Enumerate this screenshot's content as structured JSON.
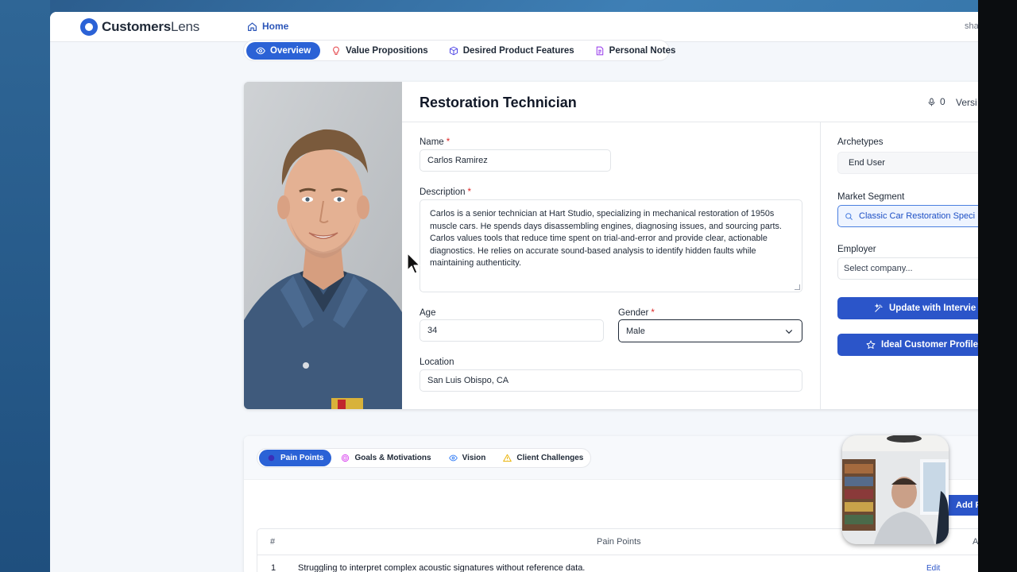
{
  "app": {
    "logo_main": "Customers",
    "logo_sub": "Lens",
    "home_label": "Home",
    "user_text": "sha"
  },
  "top_tabs": [
    {
      "label": "Overview",
      "icon": "eye-icon",
      "active": true
    },
    {
      "label": "Value Propositions",
      "icon": "lightbulb-icon",
      "active": false
    },
    {
      "label": "Desired Product Features",
      "icon": "cube-icon",
      "active": false
    },
    {
      "label": "Personal Notes",
      "icon": "document-icon",
      "active": false
    }
  ],
  "persona": {
    "title": "Restoration Technician",
    "mic_count": "0",
    "version_label": "Versi",
    "name_label": "Name",
    "name_value": "Carlos Ramirez",
    "description_label": "Description",
    "description_value": "Carlos is a senior technician at Hart Studio, specializing in mechanical restoration of 1950s muscle cars. He spends days disassembling engines, diagnosing issues, and sourcing parts. Carlos values tools that reduce time spent on trial-and-error and provide clear, actionable diagnostics. He relies on accurate sound-based analysis to identify hidden faults while maintaining authenticity.",
    "age_label": "Age",
    "age_value": "34",
    "gender_label": "Gender",
    "gender_value": "Male",
    "location_label": "Location",
    "location_value": "San Luis Obispo, CA",
    "required_mark": "*"
  },
  "side_panel": {
    "archetypes_label": "Archetypes",
    "archetypes_value": "End User",
    "market_segment_label": "Market Segment",
    "market_segment_value": "Classic Car Restoration Speci",
    "employer_label": "Employer",
    "employer_placeholder": "Select company...",
    "update_button": "Update with Intervie",
    "ideal_profile_button": "Ideal Customer Profile ("
  },
  "bottom_tabs": [
    {
      "label": "Pain Points",
      "icon": "pain-icon",
      "active": true
    },
    {
      "label": "Goals & Motivations",
      "icon": "target-icon",
      "active": false
    },
    {
      "label": "Vision",
      "icon": "eye-icon",
      "active": false
    },
    {
      "label": "Client Challenges",
      "icon": "warning-icon",
      "active": false
    }
  ],
  "pain_points": {
    "add_button": "Add P",
    "columns": [
      "#",
      "Pain Points",
      "A"
    ],
    "rows": [
      {
        "index": "1",
        "text": "Struggling to interpret complex acoustic signatures without reference data.",
        "action": "Edit"
      }
    ]
  },
  "colors": {
    "accent": "#2b62d6",
    "button": "#2b55c9",
    "required": "#dc2626"
  }
}
